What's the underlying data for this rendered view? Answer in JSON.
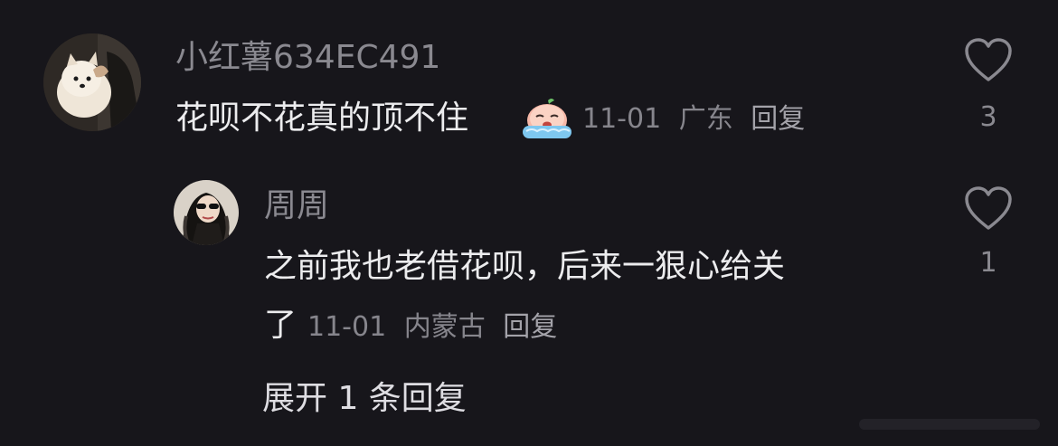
{
  "comment": {
    "username": "小红薯634EC491",
    "text": "花呗不花真的顶不住",
    "emoji": "crying-face-emoji",
    "date": "11-01",
    "location": "广东",
    "reply_label": "回复",
    "like_count": "3"
  },
  "reply": {
    "username": "周周",
    "text_line1": "之前我也老借花呗，后来一狠心给关",
    "text_line2": "了",
    "date": "11-01",
    "location": "内蒙古",
    "reply_label": "回复",
    "like_count": "1"
  },
  "expand_replies": "展开 1 条回复",
  "colors": {
    "background": "#17161b",
    "text_primary": "#ececee",
    "text_secondary": "#8a8990"
  }
}
